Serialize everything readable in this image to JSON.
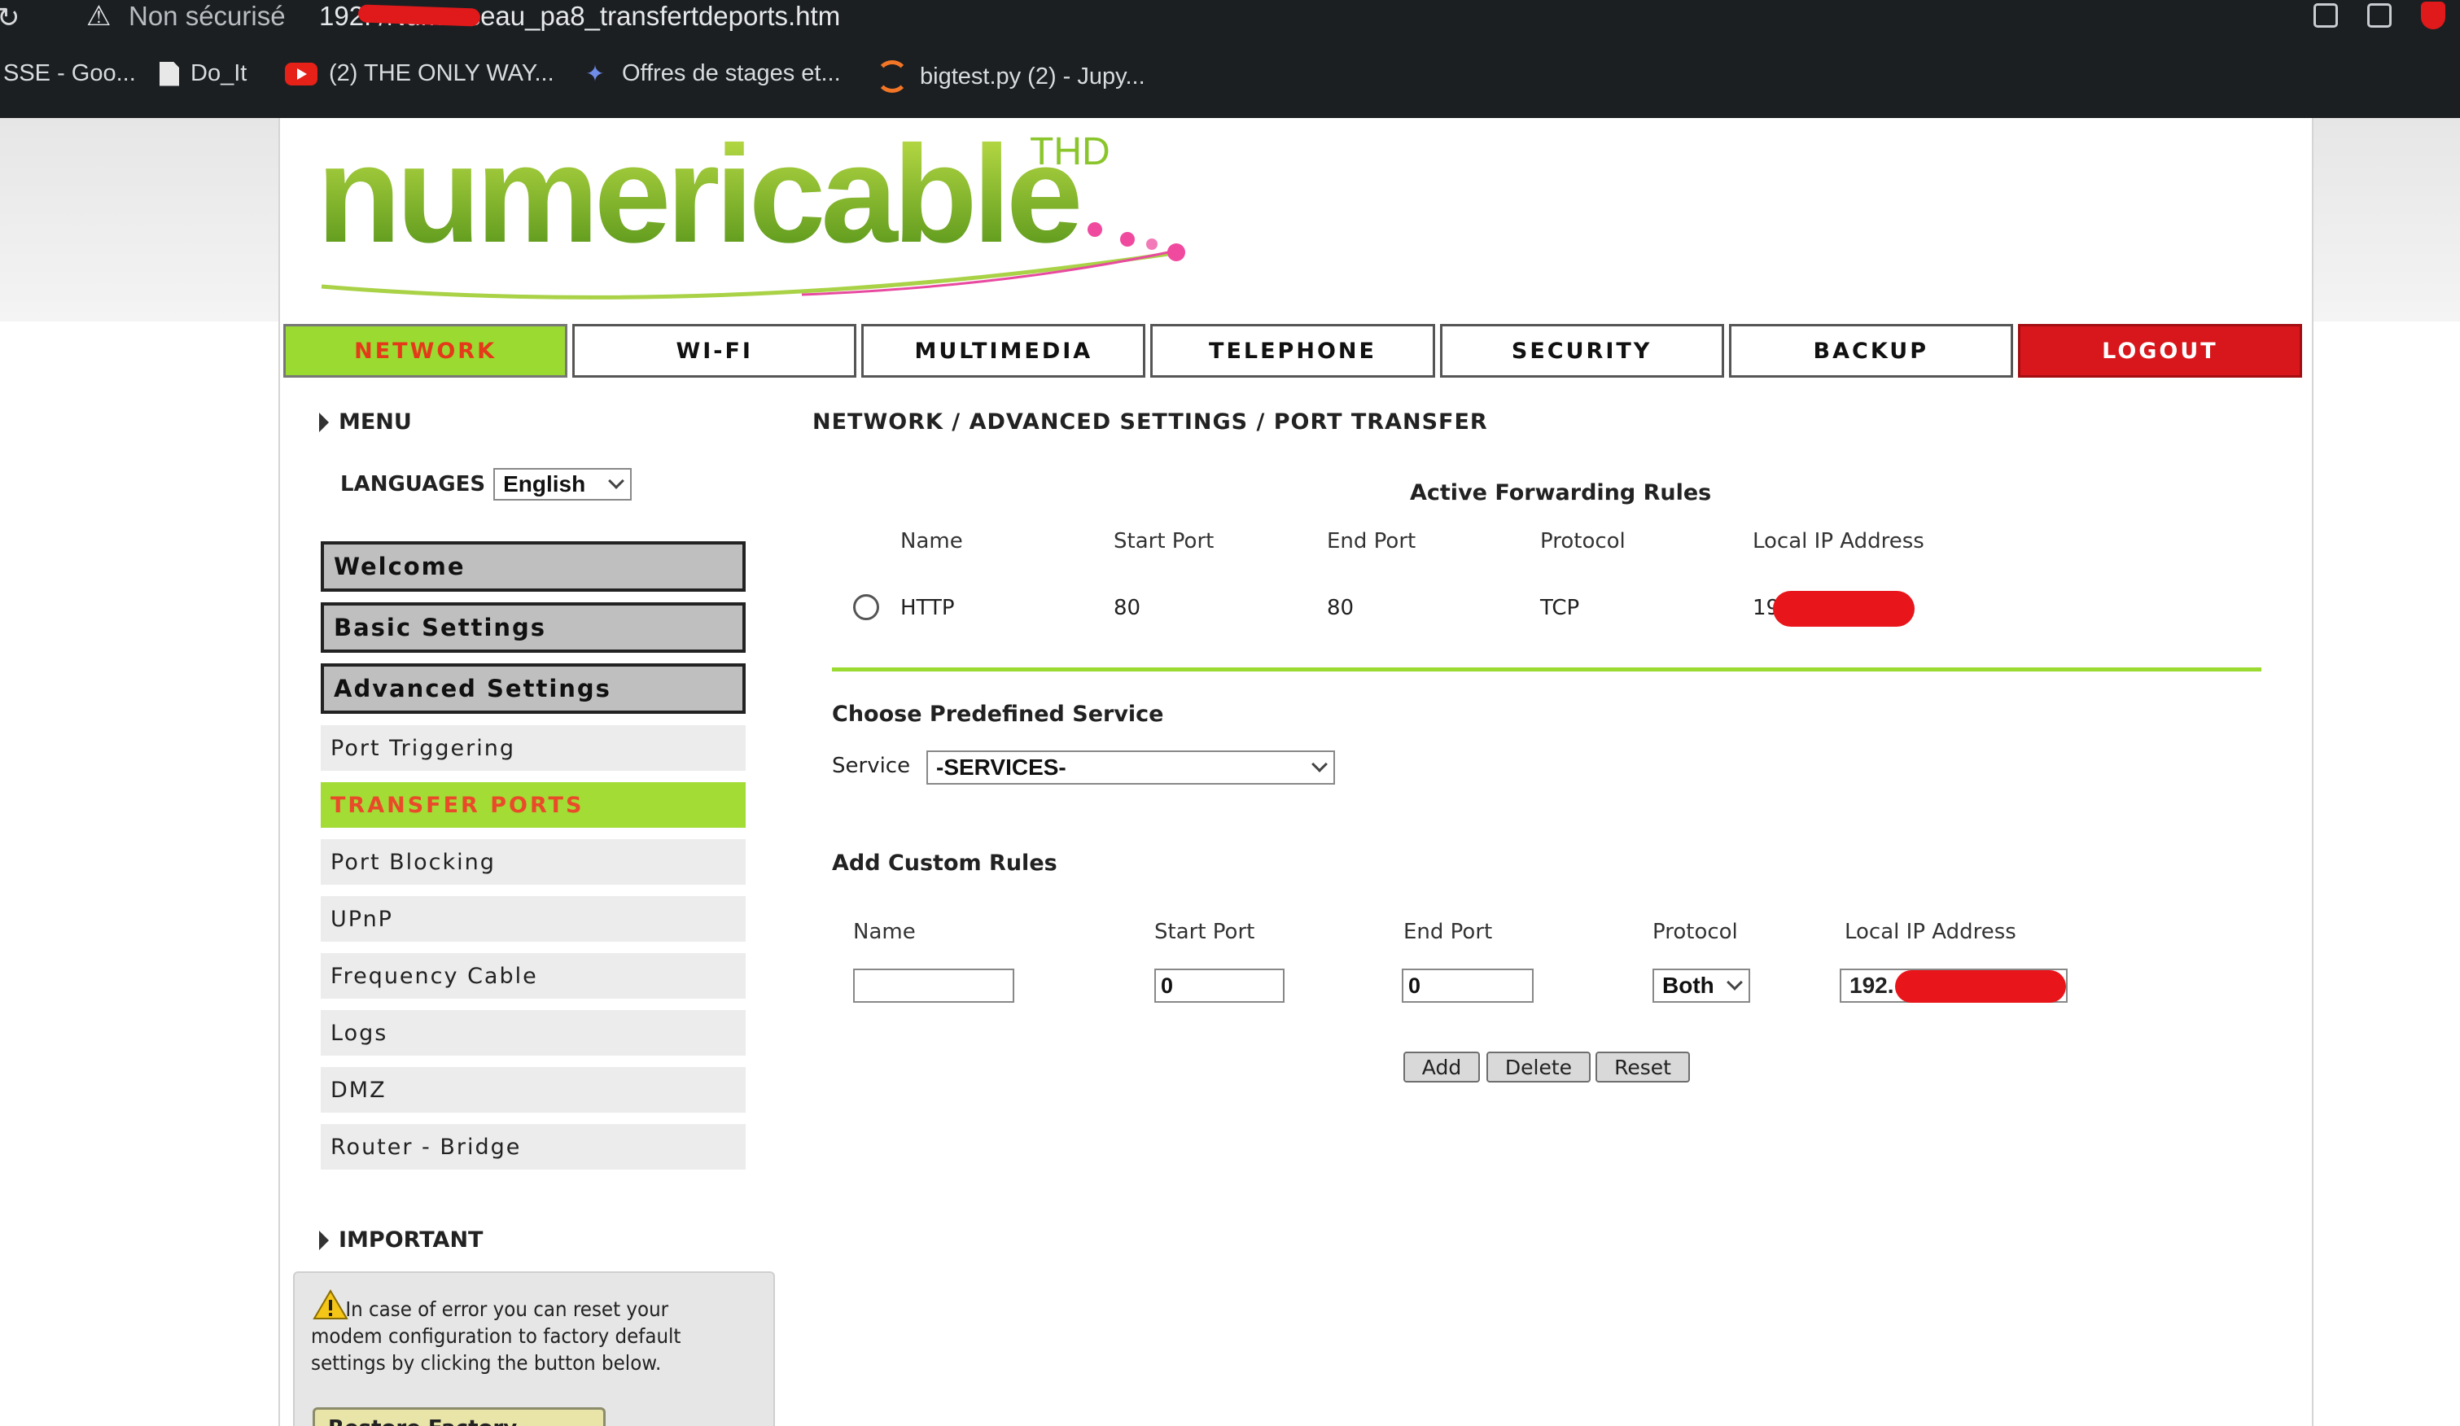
{
  "browser": {
    "security_label": "Non sécurisé",
    "url": "192.        /Numreseau_pa8_transfertdeports.htm",
    "bookmarks": [
      {
        "label": "SSE - Goo..."
      },
      {
        "label": "Do_It"
      },
      {
        "label": "(2) THE ONLY WAY..."
      },
      {
        "label": "Offres de stages et..."
      },
      {
        "label": "bigtest.py (2) - Jupy..."
      }
    ]
  },
  "logo": {
    "text": "numericable",
    "superscript": "THD"
  },
  "nav": {
    "tabs": [
      "NETWORK",
      "WI-FI",
      "MULTIMEDIA",
      "TELEPHONE",
      "SECURITY",
      "BACKUP",
      "LOGOUT"
    ],
    "active": "NETWORK"
  },
  "sidebar": {
    "menu_title": "MENU",
    "languages_label": "LANGUAGES",
    "language_value": "English",
    "sections": [
      "Welcome",
      "Basic Settings",
      "Advanced Settings"
    ],
    "items": [
      "Port Triggering",
      "TRANSFER PORTS",
      "Port Blocking",
      "UPnP",
      "Frequency Cable",
      "Logs",
      "DMZ",
      "Router - Bridge"
    ],
    "important_title": "IMPORTANT",
    "important_text": "In case of error you can reset your modem configuration to factory default settings by clicking the button below.",
    "restore_button": "Restore Factory Default"
  },
  "main": {
    "breadcrumb": "NETWORK / ADVANCED SETTINGS / PORT TRANSFER",
    "active_rules": {
      "title": "Active Forwarding Rules",
      "columns": [
        "Name",
        "Start Port",
        "End Port",
        "Protocol",
        "Local IP Address"
      ],
      "rows": [
        {
          "name": "HTTP",
          "start_port": "80",
          "end_port": "80",
          "protocol": "TCP",
          "local_ip": "192."
        }
      ]
    },
    "predefined": {
      "title": "Choose Predefined Service",
      "service_label": "Service",
      "service_value": "-SERVICES-"
    },
    "custom": {
      "title": "Add Custom Rules",
      "columns": [
        "Name",
        "Start Port",
        "End Port",
        "Protocol",
        "Local IP Address"
      ],
      "name_value": "",
      "start_port_value": "0",
      "end_port_value": "0",
      "protocol_value": "Both",
      "ip_value": "192."
    },
    "buttons": {
      "add": "Add",
      "delete": "Delete",
      "reset": "Reset"
    }
  },
  "colors": {
    "accent_green": "#9ada31",
    "active_text": "#e53a1a",
    "logout_red": "#d8171c"
  }
}
